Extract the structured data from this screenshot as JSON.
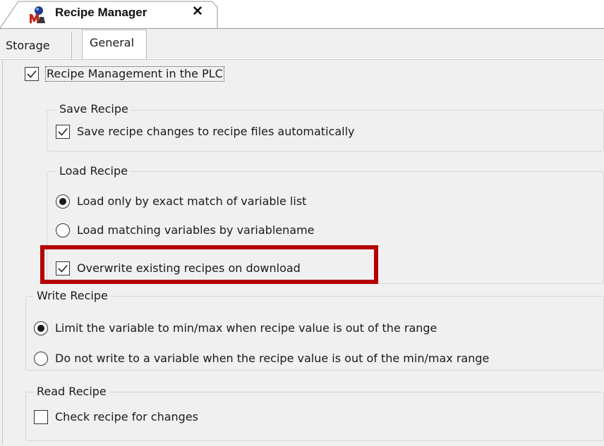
{
  "app": {
    "document_tab": {
      "title": "Recipe Manager",
      "close_glyph": "✕",
      "icon": "recipe-manager-icon"
    },
    "subtabs": [
      {
        "label": "Storage",
        "active": false
      },
      {
        "label": "General",
        "active": true
      }
    ]
  },
  "general": {
    "plc_management": {
      "label": "Recipe Management in the PLC",
      "checked": true
    },
    "save_recipe": {
      "title": "Save Recipe",
      "auto_save": {
        "label": "Save recipe changes to recipe files automatically",
        "checked": true
      }
    },
    "load_recipe": {
      "title": "Load Recipe",
      "options": [
        {
          "label": "Load only by exact match of variable list",
          "selected": true
        },
        {
          "label": "Load matching variables by variablename",
          "selected": false
        }
      ],
      "overwrite": {
        "label": "Overwrite existing recipes on download",
        "checked": true
      }
    },
    "write_recipe": {
      "title": "Write Recipe",
      "options": [
        {
          "label": "Limit the variable to min/max when recipe value is out of the range",
          "selected": true
        },
        {
          "label": "Do not write to a variable when the recipe value is out of the min/max range",
          "selected": false
        }
      ]
    },
    "read_recipe": {
      "title": "Read Recipe",
      "check_changes": {
        "label": "Check recipe for changes",
        "checked": false
      }
    }
  },
  "colors": {
    "highlight": "#b40000",
    "panel_bg": "#f0f0f0",
    "icon_red": "#c0281e",
    "icon_blue": "#1f3d8a"
  }
}
